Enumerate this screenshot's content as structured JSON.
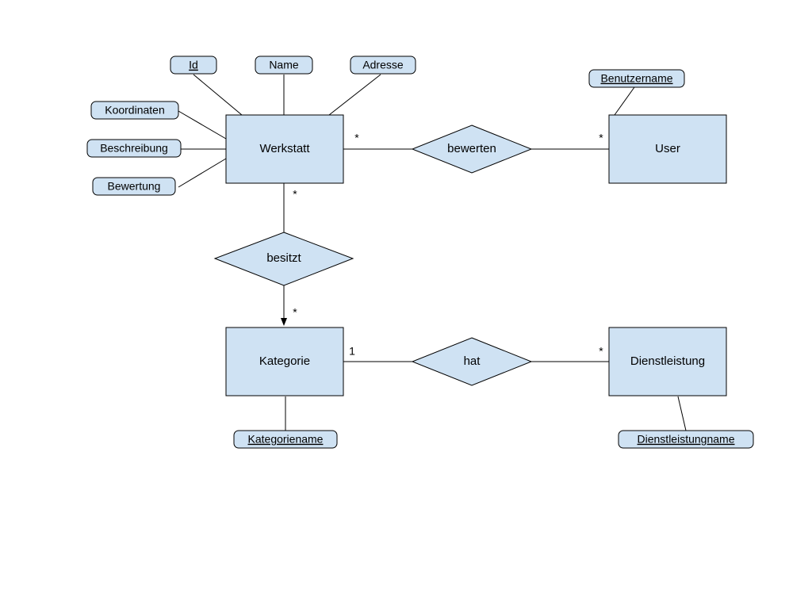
{
  "diagram": {
    "type": "ER",
    "entities": {
      "werkstatt": "Werkstatt",
      "user": "User",
      "kategorie": "Kategorie",
      "dienstleistung": "Dienstleistung"
    },
    "relationships": {
      "bewerten": "bewerten",
      "besitzt": "besitzt",
      "hat": "hat"
    },
    "attributes": {
      "id": "Id",
      "name": "Name",
      "adresse": "Adresse",
      "koordinaten": "Koordinaten",
      "beschreibung": "Beschreibung",
      "bewertung": "Bewertung",
      "benutzername": "Benutzername",
      "kategoriename": "Kategoriename",
      "dienstleistungname": "Dienstleistungname"
    },
    "cardinalities": {
      "werkstatt_bewerten": "*",
      "user_bewerten": "*",
      "werkstatt_besitzt": "*",
      "kategorie_besitzt": "*",
      "kategorie_hat": "1",
      "dienstleistung_hat": "*"
    }
  }
}
